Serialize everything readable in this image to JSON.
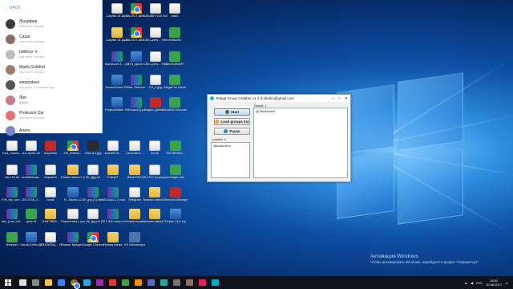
{
  "telegram": {
    "back_label": "BACK",
    "contacts": [
      {
        "name": "Люцифер",
        "status": "last seen recently",
        "color": "#3b3b3b"
      },
      {
        "name": "Саша",
        "status": "last seen recently",
        "color": "#8d6e63"
      },
      {
        "name": "hdtttnyx ✈",
        "status": "last seen recently",
        "color": "#bdbdbd"
      },
      {
        "name": "Marta Gothfrid",
        "status": "last seen recently",
        "color": "#9e7b6a"
      },
      {
        "name": "sleepydave",
        "status": "last seen 10 minutes ago",
        "color": "#555555"
      },
      {
        "name": "Лия",
        "status": "online",
        "color": "#c77b8b"
      },
      {
        "name": "Professor Ojs",
        "status": "last seen recently",
        "color": "#e57373"
      },
      {
        "name": "Artem",
        "status": "",
        "color": "#7986cb"
      }
    ]
  },
  "grabber": {
    "title": "Telega Group Grabber v1.4 d.shohin@gmail.com",
    "start_label": "Start",
    "load_label": "Load groups list",
    "pause_label": "Pause",
    "loaded_label": "Loaded: 1",
    "loaded_value": "@kulakoff.m",
    "result_label": "Result: 1",
    "result_value": "@Tamed.tarn"
  },
  "desktop_icons": [
    {
      "label": "Capital 15 Щит",
      "icon": "ico-sheet"
    },
    {
      "label": "BILOUT-a09...",
      "icon": "ico-chrome"
    },
    {
      "label": "ШЕШКН 100 Ксбас",
      "icon": "ico-sheet"
    },
    {
      "label": "parfc",
      "icon": "ico-sheet"
    },
    {
      "label": "Capital 15 Щит",
      "icon": "ico-folder"
    },
    {
      "label": "BILOUT-a09...",
      "icon": "ico-chrome"
    },
    {
      "label": "CMC-pers... Финал.docx",
      "icon": "ico-sheet"
    },
    {
      "label": "ebf8ur8u",
      "icon": "ico-green"
    },
    {
      "label": "Bandicam.r... (VK)",
      "icon": "ico-rar"
    },
    {
      "label": "8Th_lapse...",
      "icon": "ico-app"
    },
    {
      "label": "CMC-pers... Финал.docx",
      "icon": "ico-sheet"
    },
    {
      "label": "VecGuKbbFt",
      "icon": "ico-green"
    },
    {
      "label": "ZennoPoster RU 5.11.5.0",
      "icon": "ico-app"
    },
    {
      "label": "Чат. Ребонн",
      "icon": "ico-rar"
    },
    {
      "label": "Ed_1.jpg",
      "icon": "ico-sheet"
    },
    {
      "label": "MegaFun Miniti",
      "icon": "ico-green"
    },
    {
      "label": "ProjectMaker RU 5.11.5.0",
      "icon": "ico-app"
    },
    {
      "label": "Ютаре(3).ps",
      "icon": "ico-rar"
    },
    {
      "label": "Видео-Дневн...",
      "icon": "ico-red"
    },
    {
      "label": "HUAWEI Module",
      "icon": "ico-green"
    },
    {
      "label": "tord_mama...",
      "icon": "ico-sheet"
    },
    {
      "label": "ax.repekt.txt",
      "icon": "ico-sheet"
    },
    {
      "label": "AnyDesk",
      "icon": "ico-red"
    },
    {
      "label": "t30_feticha...",
      "icon": "ico-chrome"
    },
    {
      "label": "33mn14.jpg",
      "icon": "ico-dark"
    },
    {
      "label": "ArchiRC2i...",
      "icon": "ico-sheet"
    },
    {
      "label": "ZennoBox...",
      "icon": "ico-sheet"
    },
    {
      "label": "32ote",
      "icon": "ico-sheet"
    },
    {
      "label": "NeiTBMSel...",
      "icon": "ico-green"
    },
    {
      "label": "new 14.txt",
      "icon": "ico-sheet"
    },
    {
      "label": "ncmi56shap...",
      "icon": "ico-rar"
    },
    {
      "label": "Корзина",
      "icon": "ico-sheet"
    },
    {
      "label": "Новая папка 2 (2)",
      "icon": "ico-folder"
    },
    {
      "label": "5k_sjjg.txt",
      "icon": "ico-sheet"
    },
    {
      "label": "PumpiT",
      "icon": "ico-folder"
    },
    {
      "label": "(Msd1987)",
      "icon": "ico-folder"
    },
    {
      "label": "Nf1.877 регулирка.txt",
      "icon": "ico-sheet"
    },
    {
      "label": "kranfgkl.raw",
      "icon": "ico-green"
    },
    {
      "label": "Elrf_dfy_see...",
      "icon": "ico-rar"
    },
    {
      "label": "2017038_2...",
      "icon": "ico-rar"
    },
    {
      "label": "hosts",
      "icon": "ico-sheet"
    },
    {
      "label": "FL Studio 12",
      "icon": "ico-app"
    },
    {
      "label": "5k_jpg (1).xlsx",
      "icon": "ico-rar"
    },
    {
      "label": "ASIO4ALL 2 Instruction...",
      "icon": "ico-rar"
    },
    {
      "label": "Telegram",
      "icon": "ico-sheet"
    },
    {
      "label": "Личная папка Р...",
      "icon": "ico-folder"
    },
    {
      "label": "Connect Manager",
      "icon": "ico-red"
    },
    {
      "label": "aks_post_ref...",
      "icon": "ico-rar"
    },
    {
      "label": "gusLtd",
      "icon": "ico-green"
    },
    {
      "label": "*1MF3805...",
      "icon": "ico-folder"
    },
    {
      "label": "Пояснения к проведению",
      "icon": "ico-sheet"
    },
    {
      "label": "5k_jpg.txt",
      "icon": "ico-sheet"
    },
    {
      "label": "BET 920 апорт пов...",
      "icon": "ico-rar"
    },
    {
      "label": "Новая папка",
      "icon": "ico-folder"
    },
    {
      "label": "Личная папка П...",
      "icon": "ico-folder"
    },
    {
      "label": "Скрин 2(1).zip",
      "icon": "ico-app"
    },
    {
      "label": "Notepad",
      "icon": "ico-green"
    },
    {
      "label": "Visual Editor 32",
      "icon": "ico-app"
    },
    {
      "label": "ДЕКЛАРАЦ... УСН 2016Е...",
      "icon": "ico-sheet"
    },
    {
      "label": "Новые Кредит...",
      "icon": "ico-rar"
    },
    {
      "label": "Google Chrome",
      "icon": "ico-chrome"
    },
    {
      "label": "Новая папка",
      "icon": "ico-folder"
    },
    {
      "label": "VK Messenger",
      "icon": "ico-vk"
    }
  ],
  "taskbar": {
    "time": "18:52",
    "date": "20.08.2017",
    "language": "РУС"
  },
  "watermark": {
    "line1": "Активация Windows",
    "line2": "Чтобы активировать Windows, перейдите в раздел \"Параметры\"."
  }
}
